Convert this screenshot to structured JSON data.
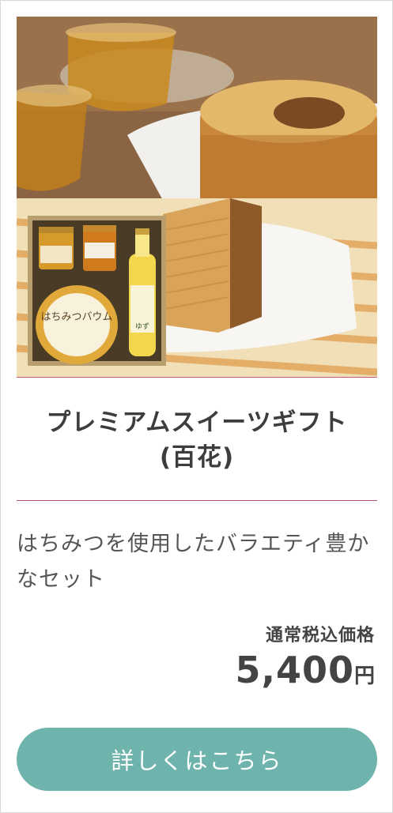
{
  "product": {
    "title_line1": "プレミアムスイーツギフト",
    "title_line2": "(百花)",
    "description": "はちみつを使用したバラエティ豊かなセット",
    "price_label": "通常税込価格",
    "price_value": "5,400",
    "price_unit": "円",
    "detail_button": "詳しくはこちら"
  },
  "image_labels": {
    "cake_tin_text": "はちみつバウム",
    "bottle_text": "ゆず"
  },
  "colors": {
    "accent_line": "#b8547a",
    "button_bg": "#6fb3ad",
    "text": "#3d3d3d"
  }
}
